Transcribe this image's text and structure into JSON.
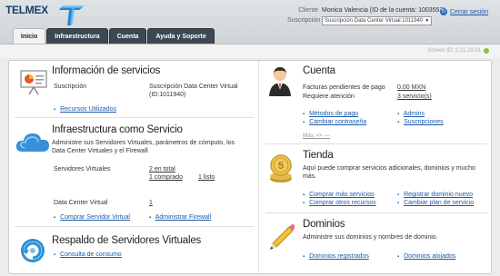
{
  "brand": {
    "logo_text": "TELMEX"
  },
  "client": {
    "client_label": "Cliente",
    "client_value": "Monica Valencia (ID de la cuenta: 1003553)",
    "subscription_label": "Suscripción",
    "subscription_value": "Suscripción Data Center Virtual:1011940",
    "logout_label": "Cerrar sesión"
  },
  "tabs": [
    {
      "label": "Inicio"
    },
    {
      "label": "Infraestructura"
    },
    {
      "label": "Cuenta"
    },
    {
      "label": "Ayuda y Soporte"
    }
  ],
  "screen_id": "Screen ID: 2.21.20.01",
  "info": {
    "title": "Información de servicios",
    "subscription_label": "Suscripción",
    "subscription_value_1": "Suscripción Data Center Virtual",
    "subscription_value_2": "(ID:1011940)",
    "link": "Recursos Utilizados"
  },
  "iaas": {
    "title": "Infraestructura como Servicio",
    "description": "Administre sus Servidores Virtuales, parámetros de cómputo, los Data Center Virtuales y el Firewall",
    "servers_label": "Servidores Virtuales",
    "servers_total": "2 en total",
    "servers_bought": "1 comprado",
    "servers_ready": "1 listo",
    "dc_label": "Data Center Virtual",
    "dc_value": "1",
    "link_buy_server": "Comprar Servidor Virtual",
    "link_firewall": "Administrar Firewall"
  },
  "backup": {
    "title": "Respaldo de Servidores Virtuales",
    "link_consumption": "Consulta de consumo"
  },
  "account": {
    "title": "Cuenta",
    "pending_label": "Facturas pendientes de pago",
    "pending_value": "0.00 MXN",
    "attention_label": "Requiere atención",
    "attention_value": "3 servicio(s)",
    "link_payment": "Métodos de pago",
    "link_admins": "Admins",
    "link_password": "Cambiar contraseña",
    "link_subscriptions": "Suscripciones",
    "more": "Más >> —"
  },
  "store": {
    "title": "Tienda",
    "description": "Aquí puede comprar servicios adicionales, dominios y mucho más.",
    "link_buy_services": "Comprar más servicios",
    "link_register_domain": "Registrar dominio nuevo",
    "link_buy_resources": "Comprar otros recursos",
    "link_change_plan": "Cambiar plan de servicio"
  },
  "domains": {
    "title": "Dominios",
    "description": "Administre sus dominios y nombres de dominio.",
    "link_registered": "Dominios registrados",
    "link_hosted": "Dominios alojados"
  },
  "colors": {
    "link": "#1a5aa8",
    "tab_dark": "#3d4854",
    "topbar": "#d8dde1"
  }
}
